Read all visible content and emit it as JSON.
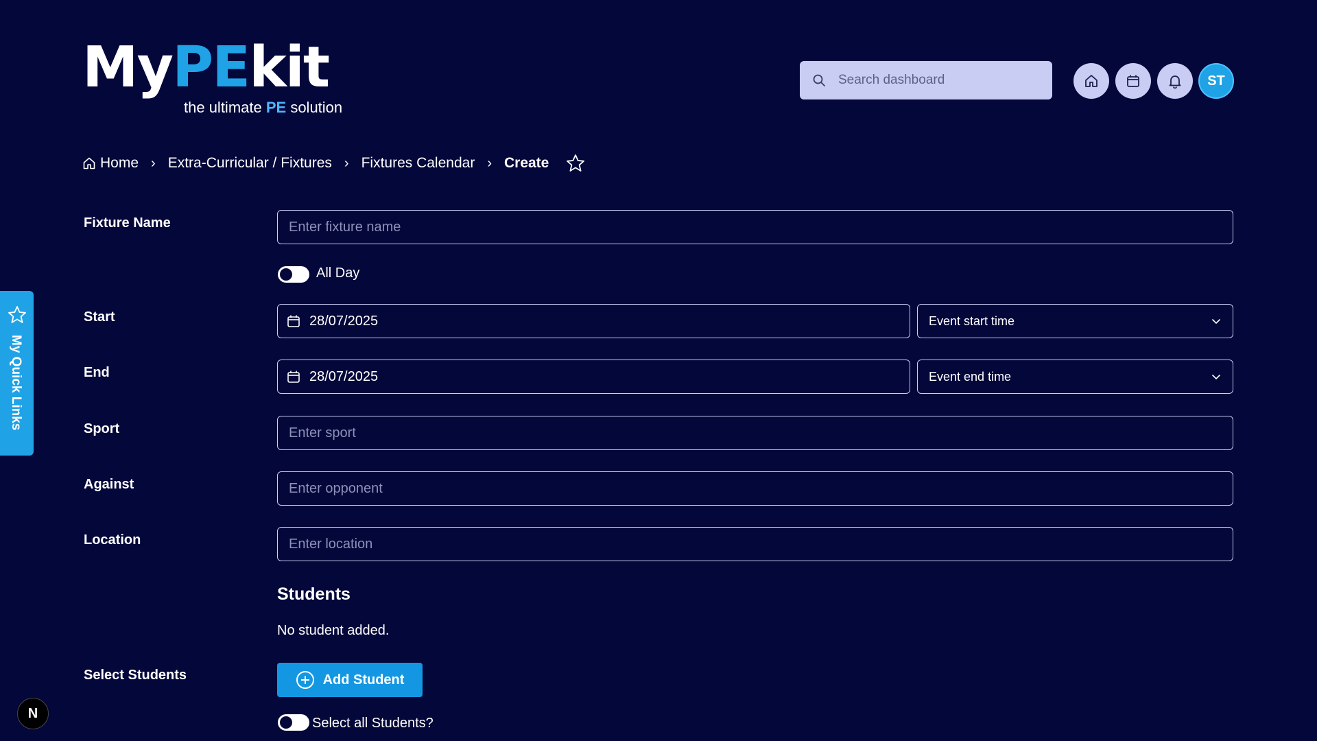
{
  "brand": {
    "logo_my": "My",
    "logo_pe": "PE",
    "logo_kit": "kit",
    "tagline_prefix": "the ultimate ",
    "tagline_pe": "PE",
    "tagline_suffix": " solution"
  },
  "header": {
    "search_placeholder": "Search dashboard",
    "avatar_initials": "ST"
  },
  "breadcrumb": {
    "home": "Home",
    "items": [
      "Extra-Curricular / Fixtures",
      "Fixtures Calendar"
    ],
    "current": "Create"
  },
  "form": {
    "fixture_name": {
      "label": "Fixture Name",
      "placeholder": "Enter fixture name"
    },
    "all_day": {
      "label": "All Day"
    },
    "start": {
      "label": "Start",
      "date": "28/07/2025",
      "time_placeholder": "Event start time"
    },
    "end": {
      "label": "End",
      "date": "28/07/2025",
      "time_placeholder": "Event end time"
    },
    "sport": {
      "label": "Sport",
      "placeholder": "Enter sport"
    },
    "against": {
      "label": "Against",
      "placeholder": "Enter opponent"
    },
    "location": {
      "label": "Location",
      "placeholder": "Enter location"
    },
    "students": {
      "title": "Students",
      "empty": "No student added.",
      "select_label": "Select Students",
      "add_button": "Add Student",
      "select_all": "Select all Students?"
    }
  },
  "quick_links": {
    "label": "My Quick Links"
  },
  "badge": {
    "letter": "N"
  },
  "colors": {
    "background": "#04073a",
    "accent": "#1fa3e6",
    "field_border": "#c9ccf3"
  }
}
